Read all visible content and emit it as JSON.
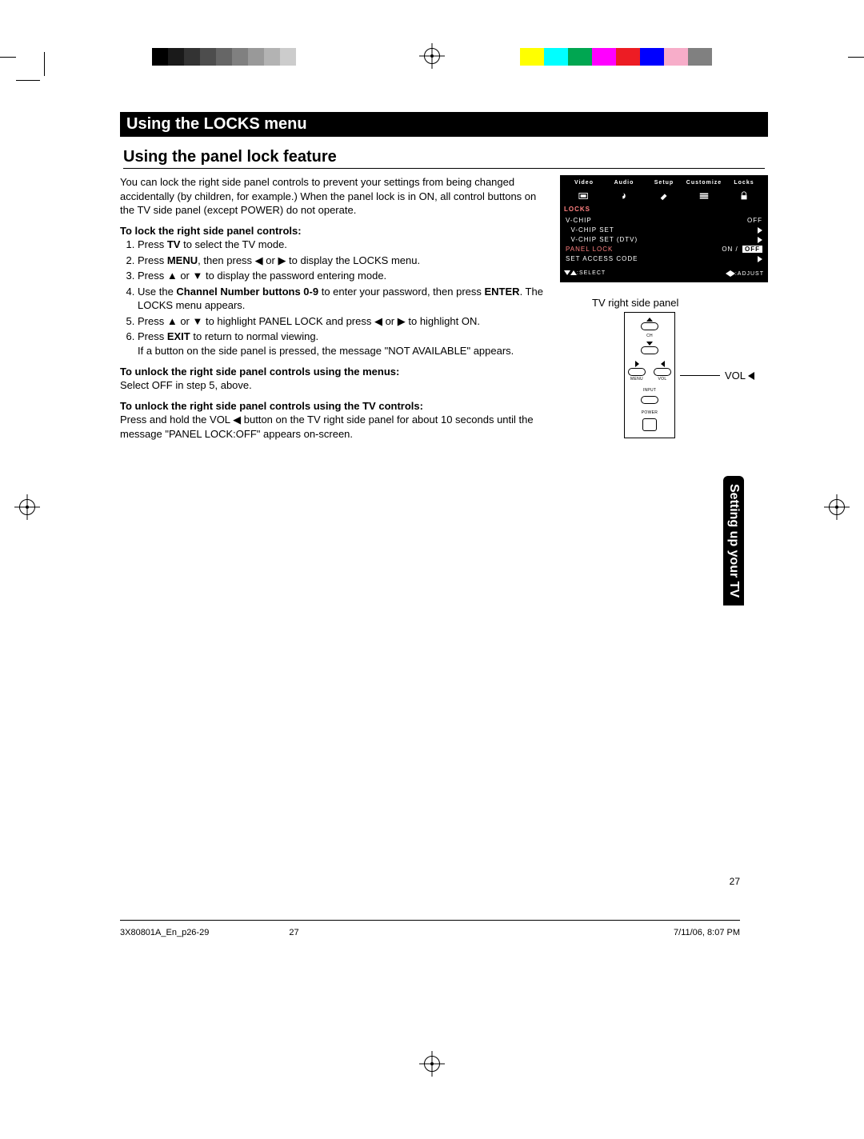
{
  "header": {
    "title": "Using the LOCKS menu"
  },
  "section": {
    "title": "Using the panel lock feature"
  },
  "intro": "You can lock the right side panel controls to prevent your settings from being changed accidentally (by children, for example.) When the panel lock is in ON, all control buttons on the TV side panel (except POWER) do not operate.",
  "lock": {
    "heading": "To lock the right side panel controls:",
    "steps": {
      "s1a": "Press ",
      "s1b": "TV",
      "s1c": " to select the TV mode.",
      "s2a": "Press ",
      "s2b": "MENU",
      "s2c": ", then press ◀ or ▶ to display the LOCKS menu.",
      "s3": "Press ▲ or ▼ to display the password entering mode.",
      "s4a": "Use the ",
      "s4b": "Channel Number buttons 0-9",
      "s4c": " to enter your password, then press ",
      "s4d": "ENTER",
      "s4e": ". The LOCKS menu appears.",
      "s5": "Press ▲ or ▼ to highlight PANEL LOCK and press ◀ or ▶ to highlight ON.",
      "s6a": "Press ",
      "s6b": "EXIT",
      "s6c": " to return to normal viewing.",
      "s6d": "If a button on the side panel is pressed, the message \"NOT AVAILABLE\" appears."
    }
  },
  "unlock_menus": {
    "heading": "To unlock the right side panel controls using the menus:",
    "body": "Select OFF in step 5, above."
  },
  "unlock_tv": {
    "heading": "To unlock the right side panel controls using the TV controls:",
    "body": "Press and hold the VOL ◀ button on the TV right side panel for about 10 seconds until the message \"PANEL LOCK:OFF\" appears on-screen."
  },
  "osd": {
    "tabs": [
      "Video",
      "Audio",
      "Setup",
      "Customize",
      "Locks"
    ],
    "title": "LOCKS",
    "rows": [
      {
        "k": "V-CHIP",
        "v": "OFF",
        "hl": false,
        "arrow": false
      },
      {
        "k": "  V-CHIP SET",
        "v": "",
        "hl": false,
        "arrow": true
      },
      {
        "k": "  V-CHIP SET (DTV)",
        "v": "",
        "hl": false,
        "arrow": true
      },
      {
        "k": "PANEL LOCK",
        "v": "ON / OFF",
        "hl": true,
        "arrow": false,
        "offbox": true
      },
      {
        "k": "SET ACCESS CODE",
        "v": "",
        "hl": false,
        "arrow": true
      }
    ],
    "footer": {
      "select": ":SELECT",
      "adjust": ":ADJUST"
    }
  },
  "panel": {
    "caption": "TV right side panel",
    "labels": {
      "ch": "CH",
      "menu": "MENU",
      "vol": "VOL",
      "input": "INPUT",
      "power": "POWER"
    },
    "vol_label": "VOL"
  },
  "sidetab": "Setting up your TV",
  "page_number": "27",
  "footer": {
    "file": "3X80801A_En_p26-29",
    "page": "27",
    "datetime": "7/11/06, 8:07 PM"
  },
  "grayscale": [
    "#000000",
    "#1a1a1a",
    "#333333",
    "#4d4d4d",
    "#666666",
    "#808080",
    "#999999",
    "#b3b3b3",
    "#cccccc",
    "#ffffff"
  ],
  "colors": [
    "#ffff00",
    "#00ffff",
    "#00a651",
    "#ff00ff",
    "#ed1c24",
    "#0000ff",
    "#f7adc9",
    "#808080"
  ]
}
